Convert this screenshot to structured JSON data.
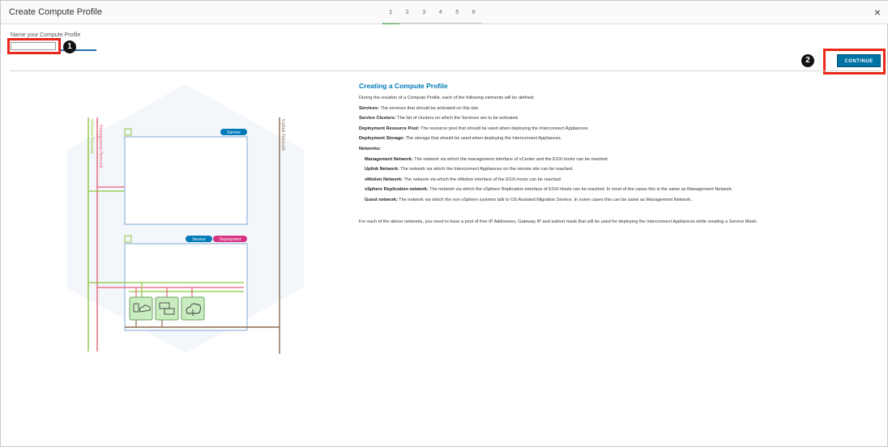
{
  "dialog": {
    "title": "Create Compute Profile",
    "steps": [
      "1",
      "2",
      "3",
      "4",
      "5",
      "6"
    ],
    "active_step": "1",
    "close_label": "×"
  },
  "form": {
    "name_label": "Name your Compute Profile",
    "name_value": ""
  },
  "callouts": {
    "one": "1",
    "two": "2"
  },
  "continue_label": "CONTINUE",
  "diagram": {
    "mgmt_network": "Management Network",
    "vmotion_network": "vMotion Network",
    "uplink_network": "Uplink Network",
    "box1_tag": "Service",
    "box2_tag_service": "Service",
    "box2_tag_deployment": "Deployment"
  },
  "info": {
    "heading": "Creating a Compute Profile",
    "intro": "During the creation of a Compute Profile, each of the following elements will be defined:",
    "items": [
      {
        "term": "Services:",
        "desc": " The services that should be activated on this site.",
        "indent": false
      },
      {
        "term": "Service Clusters:",
        "desc": " The list of clusters on which the Services are to be activated.",
        "indent": false
      },
      {
        "term": "Deployment Resource Pool:",
        "desc": " The resource pool that should be used when deploying the Interconnect Appliances.",
        "indent": false
      },
      {
        "term": "Deployment Storage:",
        "desc": " The storage that should be used when deploying the Interconnect Appliances.",
        "indent": false
      },
      {
        "term": "Networks:",
        "desc": "",
        "indent": false
      },
      {
        "term": "Management Network:",
        "desc": " The network via which the management interface of vCenter and the ESXi hosts can be reached.",
        "indent": true
      },
      {
        "term": "Uplink Network:",
        "desc": " The network via which the Interconnect Appliances on the remote site can be reached.",
        "indent": true
      },
      {
        "term": "vMotion Network:",
        "desc": " The network via which the vMotion interface of the ESXi hosts can be reached.",
        "indent": true
      },
      {
        "term": "vSphere Replication network:",
        "desc": " The network via which the vSphere Replication interface of ESXi Hosts can be reached. In most of the cases this is the same as Management Network.",
        "indent": true
      },
      {
        "term": "Guest network:",
        "desc": " The network via which the non vSphere systems talk to OS Assisted Migration Service. In some cases this can be same as Management Network.",
        "indent": true
      }
    ],
    "footer": "For each of the above networks, you need to have a pool of free IP Addresses, Gateway IP and subnet mask that will be used for deploying the Interconnect Appliances while creating a Service Mesh."
  },
  "colors": {
    "accent": "#0079b8",
    "button": "#0072a3",
    "highlight": "#e8281a",
    "mgmt": "#e8627a",
    "vmotion": "#8cc63f",
    "uplink": "#8b6a4f",
    "appliance": "#c9ecc1"
  }
}
